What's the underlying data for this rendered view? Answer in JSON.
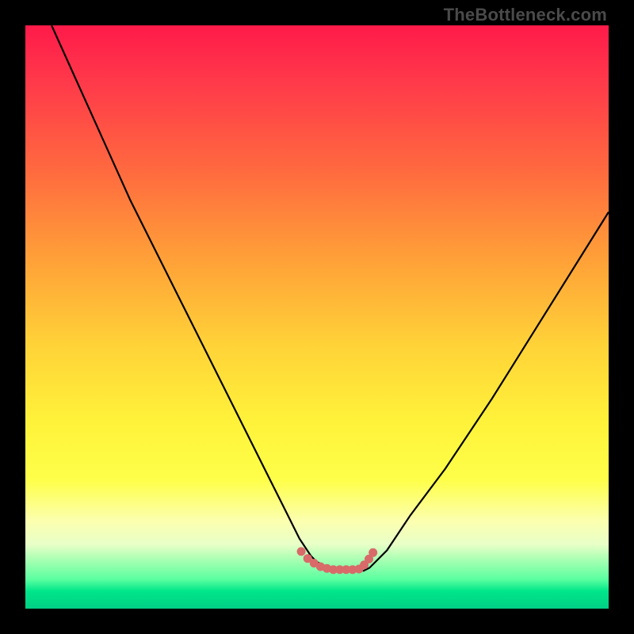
{
  "watermark": "TheBottleneck.com",
  "chart_data": {
    "type": "line",
    "title": "",
    "xlabel": "",
    "ylabel": "",
    "xlim": [
      0,
      100
    ],
    "ylim": [
      0,
      100
    ],
    "series": [
      {
        "name": "curve",
        "x": [
          4.5,
          18,
          27,
          33,
          38,
          42,
          45,
          47,
          49,
          50,
          52,
          54,
          56,
          57,
          58,
          59,
          60,
          62,
          66,
          72,
          80,
          90,
          100
        ],
        "values": [
          100,
          70,
          52,
          40,
          30,
          22,
          16,
          12,
          9,
          8,
          7,
          6.5,
          6.5,
          6.5,
          6.5,
          7,
          8,
          10,
          16,
          24,
          36,
          52,
          68
        ]
      }
    ],
    "dots": {
      "name": "dots",
      "x": [
        47.3,
        48.4,
        49.5,
        50.6,
        51.7,
        52.8,
        53.9,
        55.0,
        56.1,
        57.2,
        58.1,
        58.9,
        59.6
      ],
      "values": [
        9.8,
        8.6,
        7.8,
        7.2,
        6.9,
        6.7,
        6.7,
        6.7,
        6.7,
        6.8,
        7.5,
        8.5,
        9.6
      ]
    },
    "colors": {
      "curve": "#000000",
      "dots": "#d96a6a"
    }
  }
}
